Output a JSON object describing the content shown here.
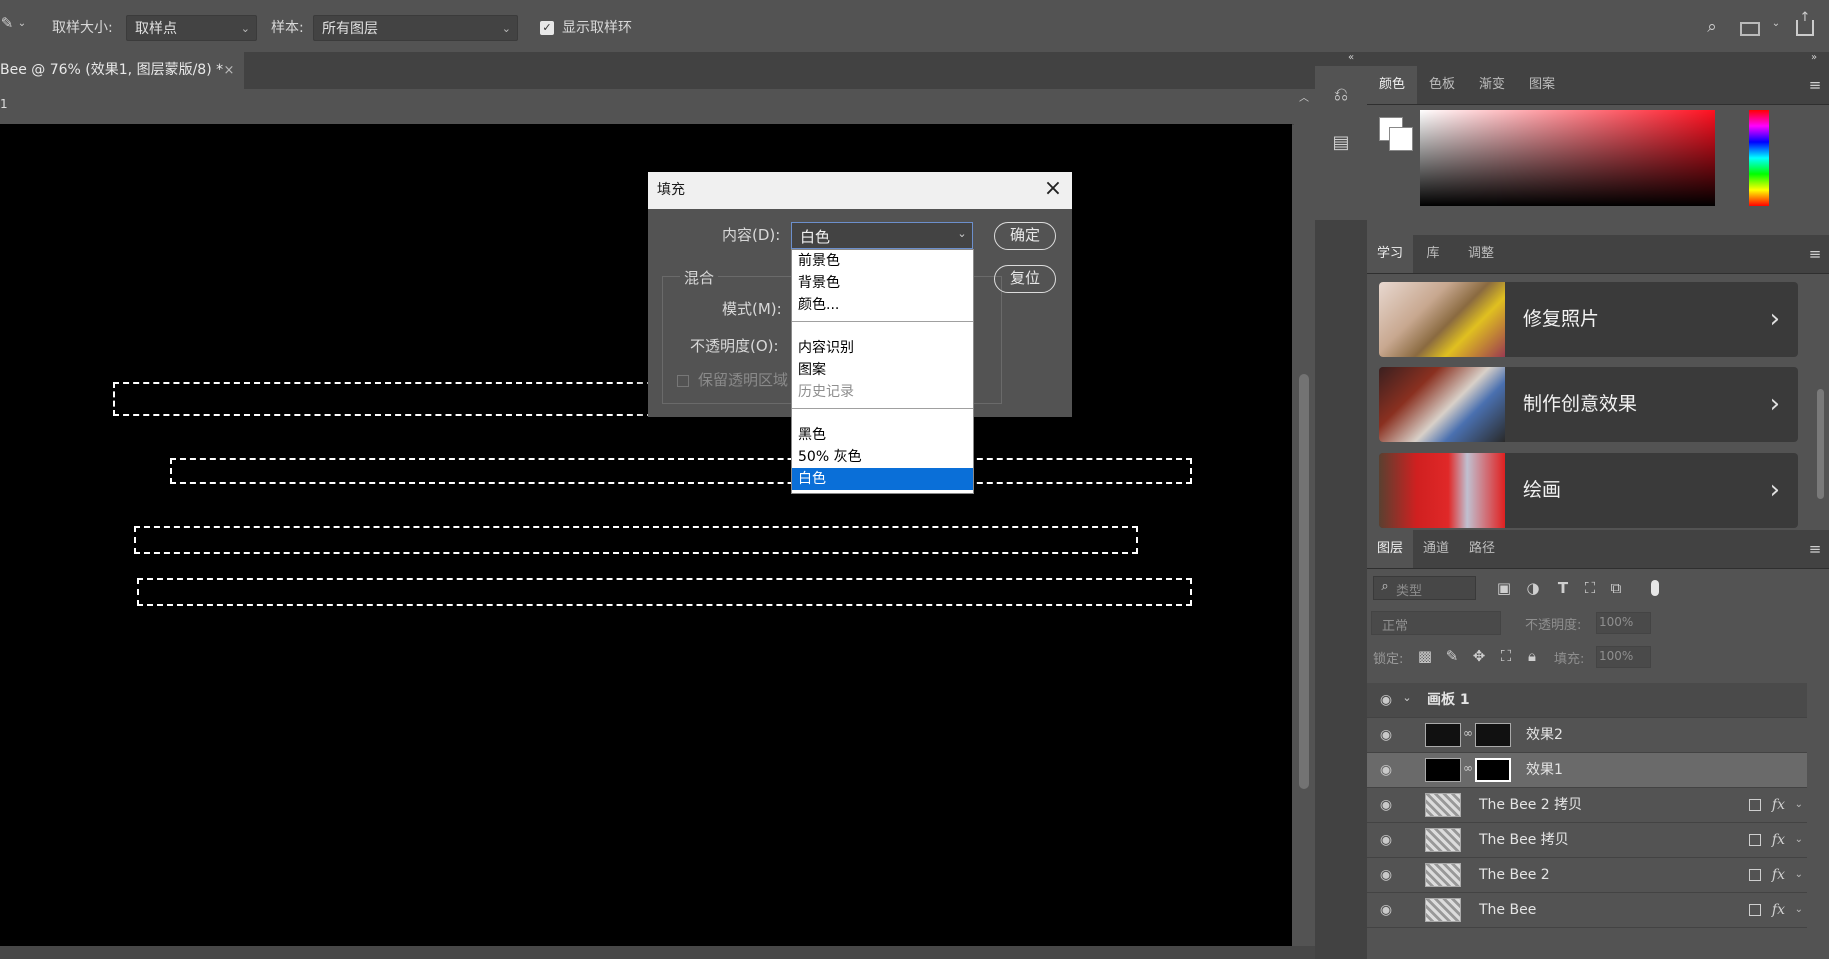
{
  "options_bar": {
    "sample_size_label": "取样大小:",
    "sample_size_value": "取样点",
    "sample_label": "样本:",
    "sample_value": "所有图层",
    "show_ring_label": "显示取样环"
  },
  "document": {
    "tab_title": "Bee @ 76% (效果1, 图层蒙版/8) *",
    "ruler_mark": "1"
  },
  "color_panel": {
    "tabs": [
      "颜色",
      "色板",
      "渐变",
      "图案"
    ]
  },
  "learn_panel": {
    "tabs": [
      "学习",
      "库",
      "调整"
    ],
    "items": [
      "修复照片",
      "制作创意效果",
      "绘画"
    ]
  },
  "layers_panel": {
    "tabs": [
      "图层",
      "通道",
      "路径"
    ],
    "filter_placeholder": "类型",
    "blend_mode": "正常",
    "opacity_label": "不透明度:",
    "opacity_value": "100%",
    "lock_label": "锁定:",
    "fill_label": "填充:",
    "fill_value": "100%",
    "group_name": "画板 1",
    "layers": [
      "效果2",
      "效果1",
      "The Bee 2 拷贝",
      "The Bee 拷贝",
      "The Bee 2",
      "The Bee"
    ]
  },
  "fill_dialog": {
    "title": "填充",
    "content_label": "内容(D):",
    "content_value": "白色",
    "blend_group_label": "混合",
    "mode_label": "模式(M):",
    "opacity_label": "不透明度(O):",
    "preserve_label": "保留透明区域",
    "ok_label": "确定",
    "reset_label": "复位",
    "options": [
      "前景色",
      "背景色",
      "颜色...",
      "内容识别",
      "图案",
      "历史记录",
      "黑色",
      "50% 灰色",
      "白色"
    ]
  }
}
